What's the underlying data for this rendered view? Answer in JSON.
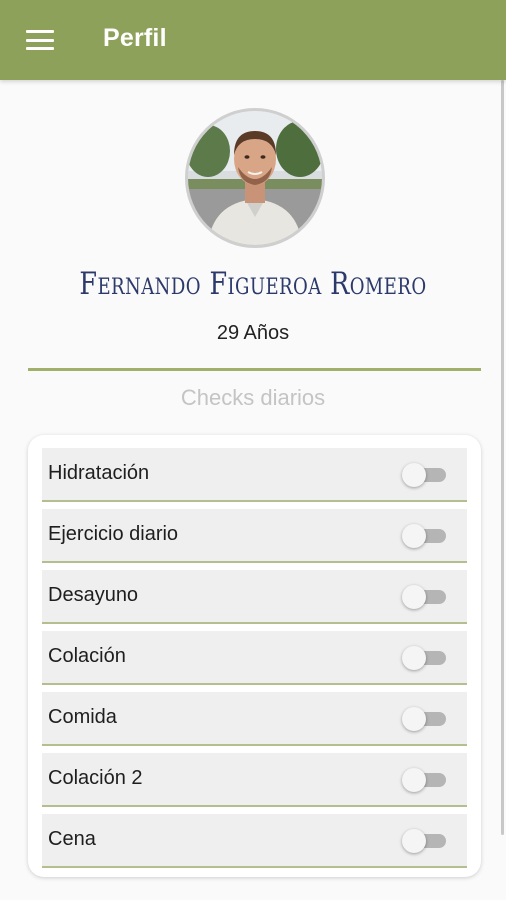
{
  "theme": {
    "primary": "#8ea15a",
    "divider": "#a0b06a"
  },
  "appbar": {
    "menu_icon": "hamburger-menu-icon",
    "title": "Perfil"
  },
  "profile": {
    "name": "Fernando Figueroa Romero",
    "age": "29 Años"
  },
  "checks": {
    "title": "Checks diarios",
    "items": [
      {
        "label": "Hidratación",
        "checked": false
      },
      {
        "label": "Ejercicio diario",
        "checked": false
      },
      {
        "label": "Desayuno",
        "checked": false
      },
      {
        "label": "Colación",
        "checked": false
      },
      {
        "label": "Comida",
        "checked": false
      },
      {
        "label": "Colación 2",
        "checked": false
      },
      {
        "label": "Cena",
        "checked": false
      }
    ]
  }
}
